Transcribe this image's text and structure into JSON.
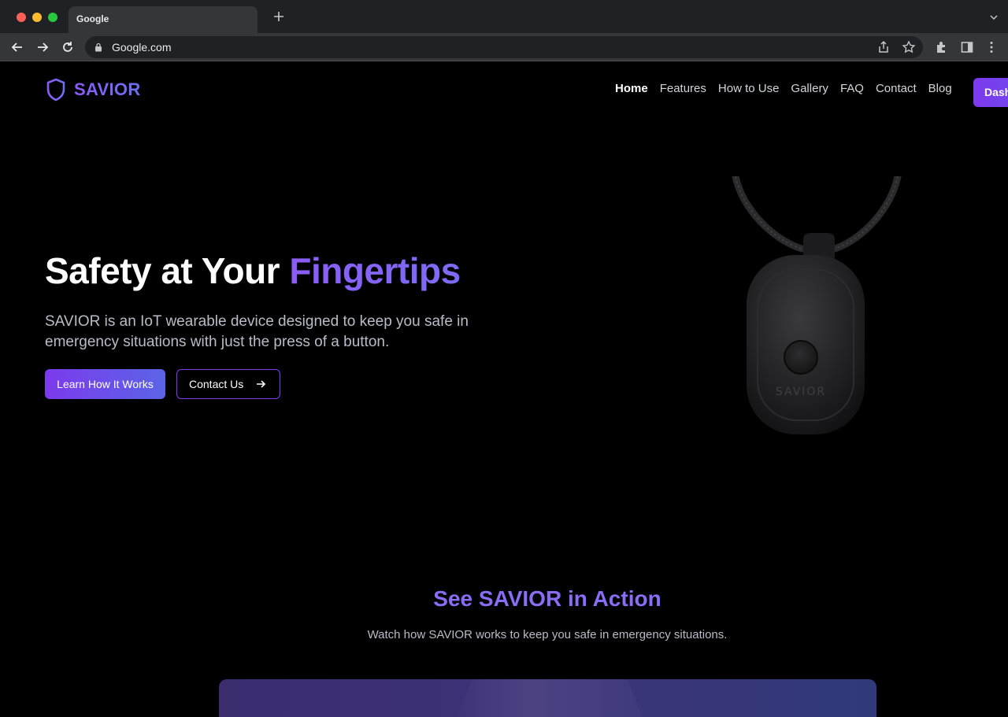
{
  "browser": {
    "tab_title": "Google",
    "new_tab_icon": "plus-icon",
    "url": "Google.com"
  },
  "site": {
    "logo_text": "SAVIOR",
    "nav": {
      "home": "Home",
      "features": "Features",
      "how_to_use": "How to Use",
      "gallery": "Gallery",
      "faq": "FAQ",
      "contact": "Contact",
      "blog": "Blog",
      "dashboard_label": "Dashboard"
    }
  },
  "hero": {
    "title_main": "Safety at Your ",
    "title_accent": "Fingertips",
    "subtitle": "SAVIOR is an IoT wearable device designed to keep you safe in emergency situations with just the press of a button.",
    "primary_button": "Learn How It Works",
    "secondary_button": "Contact Us",
    "device_label": "SAVIOR"
  },
  "section": {
    "title": "See SAVIOR in Action",
    "subtitle": "Watch how SAVIOR works to keep you safe in emergency situations."
  },
  "colors": {
    "accent": "#7c3aed",
    "accent_blue": "#5b64e6",
    "background": "#000000"
  }
}
